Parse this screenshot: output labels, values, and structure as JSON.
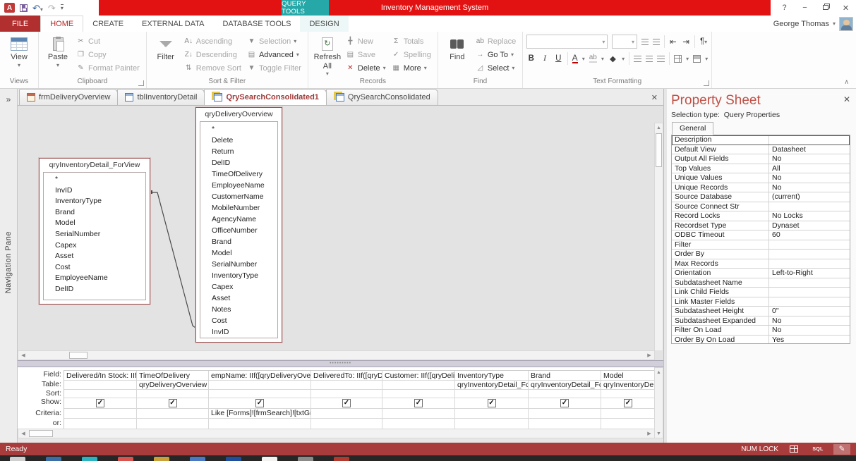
{
  "window": {
    "title": "Inventory Management System",
    "contextual_tab": "QUERY TOOLS",
    "help": "?",
    "user": "George Thomas"
  },
  "ribbon_tabs": [
    {
      "label": "FILE",
      "state": "file"
    },
    {
      "label": "HOME",
      "state": "active"
    },
    {
      "label": "CREATE",
      "state": ""
    },
    {
      "label": "EXTERNAL DATA",
      "state": ""
    },
    {
      "label": "DATABASE TOOLS",
      "state": ""
    },
    {
      "label": "DESIGN",
      "state": "contextual"
    }
  ],
  "ribbon": {
    "groups": {
      "views": {
        "caption": "Views",
        "view": "View"
      },
      "clipboard": {
        "caption": "Clipboard",
        "paste": "Paste",
        "cut": "Cut",
        "copy": "Copy",
        "format_painter": "Format Painter"
      },
      "sort_filter": {
        "caption": "Sort & Filter",
        "filter": "Filter",
        "ascending": "Ascending",
        "descending": "Descending",
        "remove_sort": "Remove Sort",
        "selection": "Selection",
        "advanced": "Advanced",
        "toggle_filter": "Toggle Filter"
      },
      "records": {
        "caption": "Records",
        "refresh_all": "Refresh All",
        "new": "New",
        "save": "Save",
        "delete": "Delete",
        "totals": "Totals",
        "spelling": "Spelling",
        "more": "More"
      },
      "find": {
        "caption": "Find",
        "find": "Find",
        "replace": "Replace",
        "go_to": "Go To",
        "select": "Select"
      },
      "text_formatting": {
        "caption": "Text Formatting",
        "bold": "B",
        "italic": "I",
        "underline": "U"
      }
    }
  },
  "doc_tabs": [
    {
      "label": "frmDeliveryOverview",
      "type": "form",
      "active": false
    },
    {
      "label": "tblInventoryDetail",
      "type": "table",
      "active": false
    },
    {
      "label": "QrySearchConsolidated1",
      "type": "query",
      "active": true
    },
    {
      "label": "QrySearchConsolidated",
      "type": "query",
      "active": false
    }
  ],
  "nav_pane": {
    "label": "Navigation Pane",
    "collapse_glyph": "»"
  },
  "design": {
    "tables": [
      {
        "title": "qryInventoryDetail_ForView",
        "fields": [
          "*",
          "InvID",
          "InventoryType",
          "Brand",
          "Model",
          "SerialNumber",
          "Capex",
          "Asset",
          "Cost",
          "EmployeeName",
          "DelID"
        ]
      },
      {
        "title": "qryDeliveryOverview",
        "fields": [
          "*",
          "Delete",
          "Return",
          "DelID",
          "TimeOfDelivery",
          "EmployeeName",
          "CustomerName",
          "MobileNumber",
          "AgencyName",
          "OfficeNumber",
          "Brand",
          "Model",
          "SerialNumber",
          "InventoryType",
          "Capex",
          "Asset",
          "Notes",
          "Cost",
          "InvID"
        ]
      }
    ]
  },
  "grid": {
    "row_labels": [
      "Field:",
      "Table:",
      "Sort:",
      "Show:",
      "Criteria:",
      "or:"
    ],
    "columns": [
      {
        "field": "Delivered/In Stock: IIf",
        "table": "",
        "show": true,
        "criteria": "",
        "width": 103
      },
      {
        "field": "TimeOfDelivery",
        "table": "qryDeliveryOverview",
        "show": true,
        "criteria": "",
        "width": 102
      },
      {
        "field": "empName: IIf([qryDeliveryOverv",
        "table": "",
        "show": true,
        "criteria": "Like [Forms]![frmSearch]![txtGive",
        "width": 145
      },
      {
        "field": "DeliveredTo: IIf([qryDe",
        "table": "",
        "show": true,
        "criteria": "",
        "width": 101
      },
      {
        "field": "Customer: IIf([qryDeliv",
        "table": "",
        "show": true,
        "criteria": "",
        "width": 103
      },
      {
        "field": "InventoryType",
        "table": "qryInventoryDetail_Fc",
        "show": true,
        "criteria": "",
        "width": 104
      },
      {
        "field": "Brand",
        "table": "qryInventoryDetail_Fc",
        "show": true,
        "criteria": "",
        "width": 103
      },
      {
        "field": "Model",
        "table": "qryInventoryDe",
        "show": true,
        "criteria": "",
        "width": 77
      }
    ]
  },
  "property_sheet": {
    "title": "Property Sheet",
    "selection_type_label": "Selection type:",
    "selection_type": "Query Properties",
    "tab": "General",
    "rows": [
      {
        "label": "Description",
        "value": "",
        "selected": true
      },
      {
        "label": "Default View",
        "value": "Datasheet"
      },
      {
        "label": "Output All Fields",
        "value": "No"
      },
      {
        "label": "Top Values",
        "value": "All"
      },
      {
        "label": "Unique Values",
        "value": "No"
      },
      {
        "label": "Unique Records",
        "value": "No"
      },
      {
        "label": "Source Database",
        "value": "(current)"
      },
      {
        "label": "Source Connect Str",
        "value": ""
      },
      {
        "label": "Record Locks",
        "value": "No Locks"
      },
      {
        "label": "Recordset Type",
        "value": "Dynaset"
      },
      {
        "label": "ODBC Timeout",
        "value": "60"
      },
      {
        "label": "Filter",
        "value": ""
      },
      {
        "label": "Order By",
        "value": ""
      },
      {
        "label": "Max Records",
        "value": ""
      },
      {
        "label": "Orientation",
        "value": "Left-to-Right"
      },
      {
        "label": "Subdatasheet Name",
        "value": ""
      },
      {
        "label": "Link Child Fields",
        "value": ""
      },
      {
        "label": "Link Master Fields",
        "value": ""
      },
      {
        "label": "Subdatasheet Height",
        "value": "0\""
      },
      {
        "label": "Subdatasheet Expanded",
        "value": "No"
      },
      {
        "label": "Filter On Load",
        "value": "No"
      },
      {
        "label": "Order By On Load",
        "value": "Yes"
      }
    ]
  },
  "status_bar": {
    "ready": "Ready",
    "num_lock": "NUM LOCK",
    "views": [
      "datasheet",
      "sql",
      "design"
    ]
  },
  "taskbar": {
    "icons": [
      "#cfcfcf",
      "#3a6ea5",
      "#2bb3c0",
      "#d9534f",
      "#c9a13b",
      "#4a78c2",
      "#1f4e9c",
      "#f2f2f2",
      "#8a8a8a",
      "#b03a2e"
    ]
  },
  "colors": {
    "titlebar_red": "#e31212",
    "contextual_teal": "#26a8a8",
    "file_tab_red": "#b12f2f",
    "status_bar_red": "#a83b3b",
    "property_title_red": "#c05046",
    "active_doc_tab_text": "#9e3a38"
  }
}
